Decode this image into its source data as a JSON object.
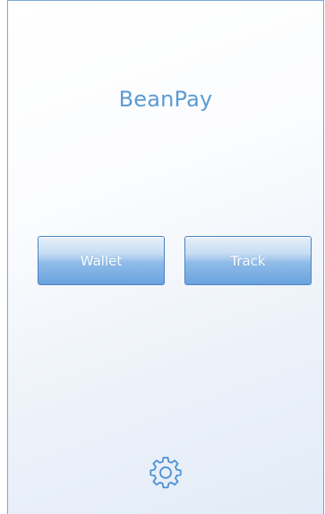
{
  "app": {
    "title": "BeanPay"
  },
  "buttons": {
    "wallet": "Wallet",
    "track": "Track"
  },
  "icons": {
    "settings": "gear-icon"
  },
  "colors": {
    "title": "#5b9bd5",
    "button_border": "#4a84c4",
    "button_text": "#ffffff",
    "icon": "#4a90d9",
    "frame": "#7ea7d8"
  }
}
